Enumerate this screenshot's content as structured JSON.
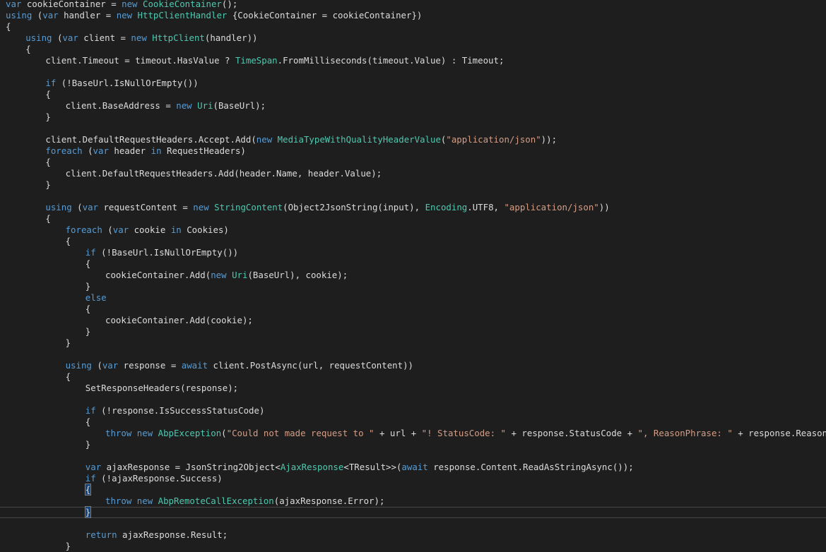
{
  "editor": {
    "theme_colors": {
      "background": "#1e1e1e",
      "keyword": "#569cd6",
      "type": "#4ec9b0",
      "string": "#d69d85",
      "text": "#dcdcdc"
    },
    "current_line": 45,
    "lines": [
      {
        "indent": 0,
        "tokens": [
          {
            "t": "var",
            "c": "kw"
          },
          {
            "t": " cookieContainer = ",
            "c": "plain"
          },
          {
            "t": "new",
            "c": "kw"
          },
          {
            "t": " ",
            "c": "plain"
          },
          {
            "t": "CookieContainer",
            "c": "type"
          },
          {
            "t": "();",
            "c": "plain"
          }
        ]
      },
      {
        "indent": 0,
        "tokens": [
          {
            "t": "using",
            "c": "kw"
          },
          {
            "t": " (",
            "c": "plain"
          },
          {
            "t": "var",
            "c": "kw"
          },
          {
            "t": " handler = ",
            "c": "plain"
          },
          {
            "t": "new",
            "c": "kw"
          },
          {
            "t": " ",
            "c": "plain"
          },
          {
            "t": "HttpClientHandler",
            "c": "type"
          },
          {
            "t": " {CookieContainer = cookieContainer})",
            "c": "plain"
          }
        ]
      },
      {
        "indent": 0,
        "tokens": [
          {
            "t": "{",
            "c": "plain"
          }
        ]
      },
      {
        "indent": 4,
        "tokens": [
          {
            "t": "using",
            "c": "kw"
          },
          {
            "t": " (",
            "c": "plain"
          },
          {
            "t": "var",
            "c": "kw"
          },
          {
            "t": " client = ",
            "c": "plain"
          },
          {
            "t": "new",
            "c": "kw"
          },
          {
            "t": " ",
            "c": "plain"
          },
          {
            "t": "HttpClient",
            "c": "type"
          },
          {
            "t": "(handler))",
            "c": "plain"
          }
        ]
      },
      {
        "indent": 4,
        "tokens": [
          {
            "t": "{",
            "c": "plain"
          }
        ]
      },
      {
        "indent": 8,
        "tokens": [
          {
            "t": "client.Timeout = timeout.HasValue ? ",
            "c": "plain"
          },
          {
            "t": "TimeSpan",
            "c": "type"
          },
          {
            "t": ".FromMilliseconds(timeout.Value) : Timeout;",
            "c": "plain"
          }
        ]
      },
      {
        "indent": 0,
        "tokens": []
      },
      {
        "indent": 8,
        "tokens": [
          {
            "t": "if",
            "c": "kw"
          },
          {
            "t": " (!BaseUrl.IsNullOrEmpty())",
            "c": "plain"
          }
        ]
      },
      {
        "indent": 8,
        "tokens": [
          {
            "t": "{",
            "c": "plain"
          }
        ]
      },
      {
        "indent": 12,
        "tokens": [
          {
            "t": "client.BaseAddress = ",
            "c": "plain"
          },
          {
            "t": "new",
            "c": "kw"
          },
          {
            "t": " ",
            "c": "plain"
          },
          {
            "t": "Uri",
            "c": "type"
          },
          {
            "t": "(BaseUrl);",
            "c": "plain"
          }
        ]
      },
      {
        "indent": 8,
        "tokens": [
          {
            "t": "}",
            "c": "plain"
          }
        ]
      },
      {
        "indent": 0,
        "tokens": []
      },
      {
        "indent": 8,
        "tokens": [
          {
            "t": "client.DefaultRequestHeaders.Accept.Add(",
            "c": "plain"
          },
          {
            "t": "new",
            "c": "kw"
          },
          {
            "t": " ",
            "c": "plain"
          },
          {
            "t": "MediaTypeWithQualityHeaderValue",
            "c": "type"
          },
          {
            "t": "(",
            "c": "plain"
          },
          {
            "t": "\"application/json\"",
            "c": "str"
          },
          {
            "t": "));",
            "c": "plain"
          }
        ]
      },
      {
        "indent": 8,
        "tokens": [
          {
            "t": "foreach",
            "c": "kw"
          },
          {
            "t": " (",
            "c": "plain"
          },
          {
            "t": "var",
            "c": "kw"
          },
          {
            "t": " header ",
            "c": "plain"
          },
          {
            "t": "in",
            "c": "kw"
          },
          {
            "t": " RequestHeaders)",
            "c": "plain"
          }
        ]
      },
      {
        "indent": 8,
        "tokens": [
          {
            "t": "{",
            "c": "plain"
          }
        ]
      },
      {
        "indent": 12,
        "tokens": [
          {
            "t": "client.DefaultRequestHeaders.Add(header.Name, header.Value);",
            "c": "plain"
          }
        ]
      },
      {
        "indent": 8,
        "tokens": [
          {
            "t": "}",
            "c": "plain"
          }
        ]
      },
      {
        "indent": 0,
        "tokens": []
      },
      {
        "indent": 8,
        "tokens": [
          {
            "t": "using",
            "c": "kw"
          },
          {
            "t": " (",
            "c": "plain"
          },
          {
            "t": "var",
            "c": "kw"
          },
          {
            "t": " requestContent = ",
            "c": "plain"
          },
          {
            "t": "new",
            "c": "kw"
          },
          {
            "t": " ",
            "c": "plain"
          },
          {
            "t": "StringContent",
            "c": "type"
          },
          {
            "t": "(Object2JsonString(input), ",
            "c": "plain"
          },
          {
            "t": "Encoding",
            "c": "type"
          },
          {
            "t": ".UTF8, ",
            "c": "plain"
          },
          {
            "t": "\"application/json\"",
            "c": "str"
          },
          {
            "t": "))",
            "c": "plain"
          }
        ]
      },
      {
        "indent": 8,
        "tokens": [
          {
            "t": "{",
            "c": "plain"
          }
        ]
      },
      {
        "indent": 12,
        "tokens": [
          {
            "t": "foreach",
            "c": "kw"
          },
          {
            "t": " (",
            "c": "plain"
          },
          {
            "t": "var",
            "c": "kw"
          },
          {
            "t": " cookie ",
            "c": "plain"
          },
          {
            "t": "in",
            "c": "kw"
          },
          {
            "t": " Cookies)",
            "c": "plain"
          }
        ]
      },
      {
        "indent": 12,
        "tokens": [
          {
            "t": "{",
            "c": "plain"
          }
        ]
      },
      {
        "indent": 16,
        "tokens": [
          {
            "t": "if",
            "c": "kw"
          },
          {
            "t": " (!BaseUrl.IsNullOrEmpty())",
            "c": "plain"
          }
        ]
      },
      {
        "indent": 16,
        "tokens": [
          {
            "t": "{",
            "c": "plain"
          }
        ]
      },
      {
        "indent": 20,
        "tokens": [
          {
            "t": "cookieContainer.Add(",
            "c": "plain"
          },
          {
            "t": "new",
            "c": "kw"
          },
          {
            "t": " ",
            "c": "plain"
          },
          {
            "t": "Uri",
            "c": "type"
          },
          {
            "t": "(BaseUrl), cookie);",
            "c": "plain"
          }
        ]
      },
      {
        "indent": 16,
        "tokens": [
          {
            "t": "}",
            "c": "plain"
          }
        ]
      },
      {
        "indent": 16,
        "tokens": [
          {
            "t": "else",
            "c": "kw"
          }
        ]
      },
      {
        "indent": 16,
        "tokens": [
          {
            "t": "{",
            "c": "plain"
          }
        ]
      },
      {
        "indent": 20,
        "tokens": [
          {
            "t": "cookieContainer.Add(cookie);",
            "c": "plain"
          }
        ]
      },
      {
        "indent": 16,
        "tokens": [
          {
            "t": "}",
            "c": "plain"
          }
        ]
      },
      {
        "indent": 12,
        "tokens": [
          {
            "t": "}",
            "c": "plain"
          }
        ]
      },
      {
        "indent": 0,
        "tokens": []
      },
      {
        "indent": 12,
        "tokens": [
          {
            "t": "using",
            "c": "kw"
          },
          {
            "t": " (",
            "c": "plain"
          },
          {
            "t": "var",
            "c": "kw"
          },
          {
            "t": " response = ",
            "c": "plain"
          },
          {
            "t": "await",
            "c": "kw"
          },
          {
            "t": " client.PostAsync(url, requestContent))",
            "c": "plain"
          }
        ]
      },
      {
        "indent": 12,
        "tokens": [
          {
            "t": "{",
            "c": "plain"
          }
        ]
      },
      {
        "indent": 16,
        "tokens": [
          {
            "t": "SetResponseHeaders(response);",
            "c": "plain"
          }
        ]
      },
      {
        "indent": 0,
        "tokens": []
      },
      {
        "indent": 16,
        "tokens": [
          {
            "t": "if",
            "c": "kw"
          },
          {
            "t": " (!response.IsSuccessStatusCode)",
            "c": "plain"
          }
        ]
      },
      {
        "indent": 16,
        "tokens": [
          {
            "t": "{",
            "c": "plain"
          }
        ]
      },
      {
        "indent": 20,
        "tokens": [
          {
            "t": "throw",
            "c": "kw"
          },
          {
            "t": " ",
            "c": "plain"
          },
          {
            "t": "new",
            "c": "kw"
          },
          {
            "t": " ",
            "c": "plain"
          },
          {
            "t": "AbpException",
            "c": "type"
          },
          {
            "t": "(",
            "c": "plain"
          },
          {
            "t": "\"Could not made request to \"",
            "c": "str"
          },
          {
            "t": " + url + ",
            "c": "plain"
          },
          {
            "t": "\"! StatusCode: \"",
            "c": "str"
          },
          {
            "t": " + response.StatusCode + ",
            "c": "plain"
          },
          {
            "t": "\", ReasonPhrase: \"",
            "c": "str"
          },
          {
            "t": " + response.ReasonPhrase);",
            "c": "plain"
          }
        ]
      },
      {
        "indent": 16,
        "tokens": [
          {
            "t": "}",
            "c": "plain"
          }
        ]
      },
      {
        "indent": 0,
        "tokens": []
      },
      {
        "indent": 16,
        "tokens": [
          {
            "t": "var",
            "c": "kw"
          },
          {
            "t": " ajaxResponse = JsonString2Object<",
            "c": "plain"
          },
          {
            "t": "AjaxResponse",
            "c": "type"
          },
          {
            "t": "<TResult>>(",
            "c": "plain"
          },
          {
            "t": "await",
            "c": "kw"
          },
          {
            "t": " response.Content.ReadAsStringAsync());",
            "c": "plain"
          }
        ]
      },
      {
        "indent": 16,
        "tokens": [
          {
            "t": "if",
            "c": "kw"
          },
          {
            "t": " (!ajaxResponse.Success)",
            "c": "plain"
          }
        ]
      },
      {
        "indent": 16,
        "tokens": [
          {
            "t": "{",
            "c": "brace"
          }
        ]
      },
      {
        "indent": 20,
        "tokens": [
          {
            "t": "throw",
            "c": "kw"
          },
          {
            "t": " ",
            "c": "plain"
          },
          {
            "t": "new",
            "c": "kw"
          },
          {
            "t": " ",
            "c": "plain"
          },
          {
            "t": "AbpRemoteCallException",
            "c": "type"
          },
          {
            "t": "(ajaxResponse.Error);",
            "c": "plain"
          }
        ]
      },
      {
        "indent": 16,
        "tokens": [
          {
            "t": "}",
            "c": "brace"
          },
          {
            "t": "",
            "c": "caret"
          }
        ]
      },
      {
        "indent": 0,
        "tokens": []
      },
      {
        "indent": 16,
        "tokens": [
          {
            "t": "return",
            "c": "kw"
          },
          {
            "t": " ajaxResponse.Result;",
            "c": "plain"
          }
        ]
      },
      {
        "indent": 12,
        "tokens": [
          {
            "t": "}",
            "c": "plain"
          }
        ]
      }
    ]
  }
}
